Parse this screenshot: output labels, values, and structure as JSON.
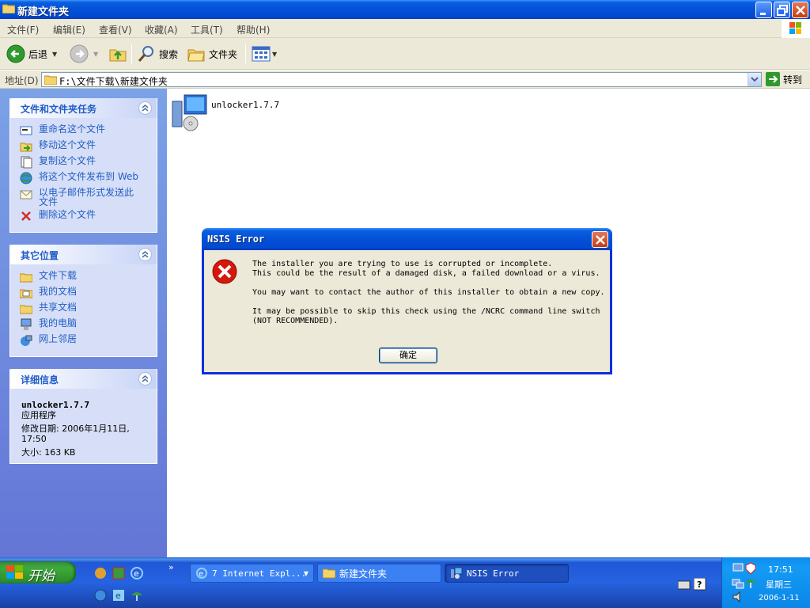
{
  "window": {
    "title": "新建文件夹"
  },
  "menu": {
    "items": [
      "文件(F)",
      "编辑(E)",
      "查看(V)",
      "收藏(A)",
      "工具(T)",
      "帮助(H)"
    ]
  },
  "toolbar": {
    "back_label": "后退",
    "search_label": "搜索",
    "folders_label": "文件夹"
  },
  "address": {
    "label": "地址(D)",
    "value": "F:\\文件下载\\新建文件夹",
    "go_label": "转到"
  },
  "taskpane": {
    "file_tasks": {
      "title": "文件和文件夹任务",
      "items": [
        {
          "label": "重命名这个文件",
          "icon": "rename-icon"
        },
        {
          "label": "移动这个文件",
          "icon": "move-icon"
        },
        {
          "label": "复制这个文件",
          "icon": "copy-icon"
        },
        {
          "label": "将这个文件发布到 Web",
          "icon": "publish-web-icon"
        },
        {
          "label": "以电子邮件形式发送此文件",
          "icon": "email-icon"
        },
        {
          "label": "删除这个文件",
          "icon": "delete-icon"
        }
      ]
    },
    "other_places": {
      "title": "其它位置",
      "items": [
        {
          "label": "文件下载",
          "icon": "folder-icon"
        },
        {
          "label": "我的文档",
          "icon": "my-documents-icon"
        },
        {
          "label": "共享文档",
          "icon": "shared-folder-icon"
        },
        {
          "label": "我的电脑",
          "icon": "my-computer-icon"
        },
        {
          "label": "网上邻居",
          "icon": "network-icon"
        }
      ]
    },
    "details": {
      "title": "详细信息",
      "file_name": "unlocker1.7.7",
      "file_type": "应用程序",
      "modified": "修改日期: 2006年1月11日, 17:50",
      "size": "大小: 163 KB"
    }
  },
  "content": {
    "files": [
      {
        "name": "unlocker1.7.7",
        "icon": "installer-icon"
      }
    ]
  },
  "dialog": {
    "title": "NSIS Error",
    "message": "The installer you are trying to use is corrupted or incomplete.\nThis could be the result of a damaged disk, a failed download or a virus.\n\nYou may want to contact the author of this installer to obtain a new copy.\n\nIt may be possible to skip this check using the /NCRC command line switch\n(NOT RECOMMENDED).",
    "ok_label": "确定",
    "icon": "error-icon"
  },
  "taskbar": {
    "start_label": "开始",
    "buttons": [
      {
        "label": "7 Internet Expl...",
        "icon": "ie-icon"
      },
      {
        "label": "新建文件夹",
        "icon": "folder-icon"
      },
      {
        "label": "NSIS Error",
        "icon": "installer-icon"
      }
    ],
    "quicklaunch_more": "»",
    "clock_time": "17:51",
    "clock_day": "星期三",
    "clock_date": "2006-1-11"
  }
}
